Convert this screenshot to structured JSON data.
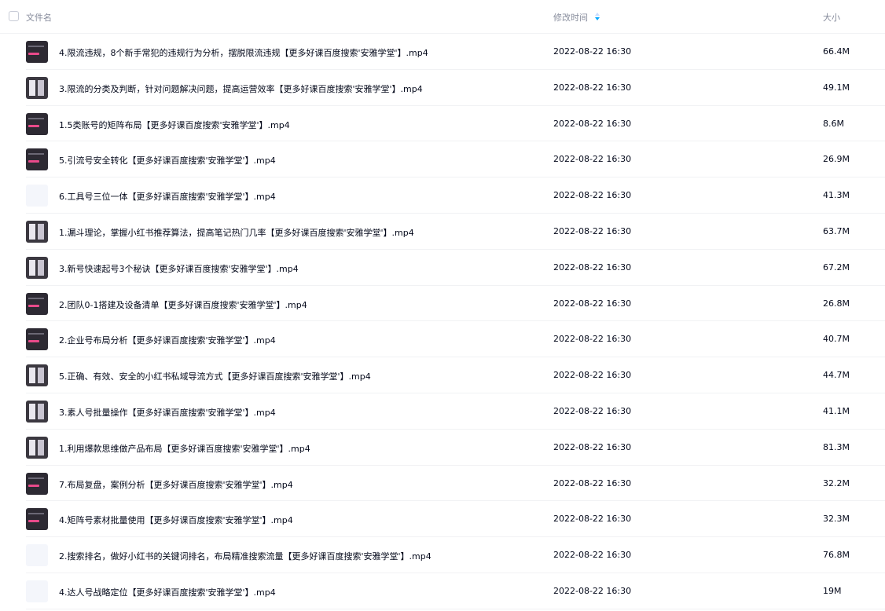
{
  "header": {
    "name_label": "文件名",
    "time_label": "修改时间",
    "size_label": "大小",
    "sort_icon": "sort-desc-icon"
  },
  "files": [
    {
      "name": "4.限流违规，8个新手常犯的违规行为分析，摆脱限流违规【更多好课百度搜索'安雅学堂'】.mp4",
      "time": "2022-08-22 16:30",
      "size": "66.4M",
      "thumb": "dark"
    },
    {
      "name": "3.限流的分类及判断，针对问题解决问题，提高运营效率【更多好课百度搜索'安雅学堂'】.mp4",
      "time": "2022-08-22 16:30",
      "size": "49.1M",
      "thumb": "mixed"
    },
    {
      "name": "1.5类账号的矩阵布局【更多好课百度搜索'安雅学堂'】.mp4",
      "time": "2022-08-22 16:30",
      "size": "8.6M",
      "thumb": "dark"
    },
    {
      "name": "5.引流号安全转化【更多好课百度搜索'安雅学堂'】.mp4",
      "time": "2022-08-22 16:30",
      "size": "26.9M",
      "thumb": "dark"
    },
    {
      "name": "6.工具号三位一体【更多好课百度搜索'安雅学堂'】.mp4",
      "time": "2022-08-22 16:30",
      "size": "41.3M",
      "thumb": "light"
    },
    {
      "name": "1.漏斗理论，掌握小红书推荐算法，提高笔记热门几率【更多好课百度搜索'安雅学堂'】.mp4",
      "time": "2022-08-22 16:30",
      "size": "63.7M",
      "thumb": "mixed"
    },
    {
      "name": "3.新号快速起号3个秘诀【更多好课百度搜索'安雅学堂'】.mp4",
      "time": "2022-08-22 16:30",
      "size": "67.2M",
      "thumb": "mixed"
    },
    {
      "name": "2.团队0-1搭建及设备清单【更多好课百度搜索'安雅学堂'】.mp4",
      "time": "2022-08-22 16:30",
      "size": "26.8M",
      "thumb": "dark"
    },
    {
      "name": "2.企业号布局分析【更多好课百度搜索'安雅学堂'】.mp4",
      "time": "2022-08-22 16:30",
      "size": "40.7M",
      "thumb": "dark"
    },
    {
      "name": "5.正确、有效、安全的小红书私域导流方式【更多好课百度搜索'安雅学堂'】.mp4",
      "time": "2022-08-22 16:30",
      "size": "44.7M",
      "thumb": "mixed"
    },
    {
      "name": "3.素人号批量操作【更多好课百度搜索'安雅学堂'】.mp4",
      "time": "2022-08-22 16:30",
      "size": "41.1M",
      "thumb": "mixed"
    },
    {
      "name": "1.利用爆款思维做产品布局【更多好课百度搜索'安雅学堂'】.mp4",
      "time": "2022-08-22 16:30",
      "size": "81.3M",
      "thumb": "mixed"
    },
    {
      "name": "7.布局复盘，案例分析【更多好课百度搜索'安雅学堂'】.mp4",
      "time": "2022-08-22 16:30",
      "size": "32.2M",
      "thumb": "dark"
    },
    {
      "name": "4.矩阵号素材批量使用【更多好课百度搜索'安雅学堂'】.mp4",
      "time": "2022-08-22 16:30",
      "size": "32.3M",
      "thumb": "dark"
    },
    {
      "name": "2.搜索排名，做好小红书的关键词排名，布局精准搜索流量【更多好课百度搜索'安雅学堂'】.mp4",
      "time": "2022-08-22 16:30",
      "size": "76.8M",
      "thumb": "light"
    },
    {
      "name": "4.达人号战略定位【更多好课百度搜索'安雅学堂'】.mp4",
      "time": "2022-08-22 16:30",
      "size": "19M",
      "thumb": "light"
    }
  ]
}
